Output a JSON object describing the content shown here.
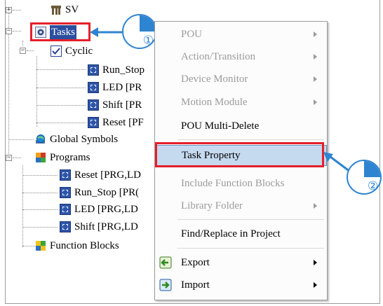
{
  "tree": {
    "sv": "SV",
    "tasks": "Tasks",
    "cyclic": "Cyclic",
    "task_items": [
      "Run_Stop",
      "LED [PR",
      "Shift [PR",
      "Reset [PF"
    ],
    "global_symbols": "Global Symbols",
    "programs": "Programs",
    "program_items": [
      "Reset [PRG,LD",
      "Run_Stop [PR(",
      "LED [PRG,LD",
      "Shift [PRG,LD"
    ],
    "function_blocks": "Function Blocks"
  },
  "context_menu": {
    "pou": "POU",
    "action_transition": "Action/Transition",
    "device_monitor": "Device Monitor",
    "motion_module": "Motion Module",
    "pou_multi_delete": "POU Multi-Delete",
    "task_property": "Task Property",
    "include_function_blocks": "Include Function Blocks",
    "library_folder": "Library Folder",
    "find_replace": "Find/Replace in Project",
    "export": "Export",
    "import": "Import"
  },
  "callouts": {
    "step1": "①",
    "step2": "②"
  },
  "colors": {
    "highlight_red": "#e4202a",
    "callout_blue": "#2e84d0",
    "menu_highlight": "#c5d9ef",
    "disabled_text": "#9b9b9b"
  }
}
